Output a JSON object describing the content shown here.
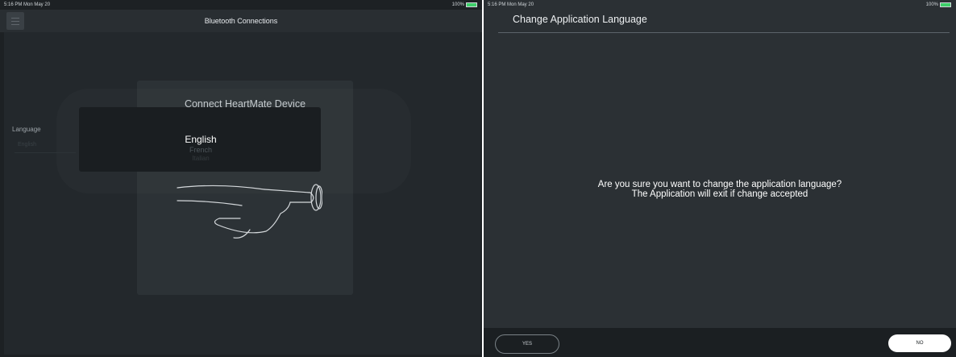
{
  "left_screen": {
    "status": {
      "time": "5:16 PM  Mon May 20",
      "battery": "100%"
    },
    "header": {
      "title": "Bluetooth Connections",
      "menu_icon": "hamburger-menu-icon"
    },
    "card": {
      "title": "Connect HeartMate Device",
      "illustration": "finger-pressing-button-icon"
    },
    "language": {
      "label": "Language",
      "value": "English"
    },
    "picker": {
      "options": [
        "English",
        "French",
        "Italian"
      ],
      "selected": "English"
    }
  },
  "right_screen": {
    "status": {
      "time": "5:16 PM  Mon May 20",
      "battery": "100%"
    },
    "title": "Change Application Language",
    "message_line1": "Are you sure you want to change the application language?",
    "message_line2": "The Application will exit if change accepted",
    "buttons": {
      "yes": "YES",
      "no": "NO"
    }
  },
  "colors": {
    "accent_battery": "#3ecf6a",
    "background_dark": "#1d2124",
    "dialog_background": "#2b3034"
  }
}
